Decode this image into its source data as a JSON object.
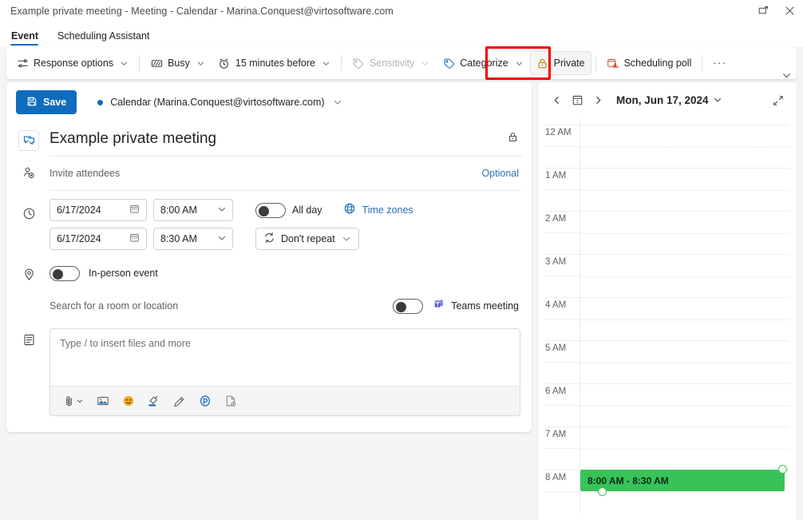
{
  "window": {
    "title": "Example private meeting - Meeting - Calendar - Marina.Conquest@virtosoftware.com",
    "popout_icon": "popout-icon",
    "close_icon": "close-icon"
  },
  "tabs": [
    {
      "label": "Event",
      "selected": true
    },
    {
      "label": "Scheduling Assistant",
      "selected": false
    }
  ],
  "ribbon": {
    "items": [
      {
        "label": "Response options",
        "icon": "response-options-icon",
        "chevron": true,
        "disabled": false
      },
      {
        "label": "Busy",
        "icon": "busy-icon",
        "chevron": true,
        "disabled": false
      },
      {
        "label": "15 minutes before",
        "icon": "reminder-clock-icon",
        "chevron": true,
        "disabled": false
      },
      {
        "label": "Sensitivity",
        "icon": "sensitivity-icon",
        "chevron": true,
        "disabled": true
      },
      {
        "label": "Categorize",
        "icon": "categorize-tag-icon",
        "chevron": true,
        "disabled": false
      },
      {
        "label": "Private",
        "icon": "private-lock-icon",
        "chevron": false,
        "disabled": false,
        "highlighted": true
      },
      {
        "label": "Scheduling poll",
        "icon": "scheduling-poll-icon",
        "chevron": false,
        "disabled": false
      }
    ],
    "overflow_label": "···",
    "expand_icon": "chevron-down-icon",
    "annotation_color": "#ee0000"
  },
  "form": {
    "save_label": "Save",
    "save_icon": "save-disk-icon",
    "save_color": "#0f6cbd",
    "calendar_label": "Calendar (Marina.Conquest@virtosoftware.com)",
    "calendar_dot_color": "#0f6cbd",
    "subject": "Example private meeting",
    "subject_icon": "teams-meeting-icon",
    "private_lock_icon": "lock-icon",
    "attendees_placeholder": "Invite attendees",
    "attendees_icon": "add-people-icon",
    "optional_label": "Optional",
    "clock_icon": "clock-icon",
    "start_date": "6/17/2024",
    "start_time": "8:00 AM",
    "end_date": "6/17/2024",
    "end_time": "8:30 AM",
    "date_picker_icon": "calendar-icon",
    "all_day_label": "All day",
    "all_day_on": false,
    "time_zones_label": "Time zones",
    "time_zones_icon": "globe-icon",
    "repeat_label": "Don't repeat",
    "repeat_icon": "repeat-icon",
    "location_icon": "location-pin-icon",
    "in_person_label": "In-person event",
    "in_person_on": false,
    "location_placeholder": "Search for a room or location",
    "teams_label": "Teams meeting",
    "teams_icon": "teams-icon",
    "teams_on": false,
    "description_icon": "description-icon",
    "body_placeholder": "Type / to insert files and more",
    "format_tools": [
      {
        "name": "attach-file-icon",
        "chevron": true
      },
      {
        "name": "insert-picture-icon",
        "chevron": false
      },
      {
        "name": "emoji-icon",
        "chevron": false
      },
      {
        "name": "highlighter-icon",
        "chevron": false
      },
      {
        "name": "draw-pen-icon",
        "chevron": false
      },
      {
        "name": "loop-component-icon",
        "chevron": false
      },
      {
        "name": "insert-document-icon",
        "chevron": false
      }
    ]
  },
  "calendar_pane": {
    "prev_icon": "chevron-left-icon",
    "today_icon": "today-calendar-icon",
    "next_icon": "chevron-right-icon",
    "date_label": "Mon, Jun 17, 2024",
    "date_chevron_icon": "chevron-down-icon",
    "expand_icon": "expand-diagonal-icon",
    "hours": [
      "12 AM",
      "1 AM",
      "2 AM",
      "3 AM",
      "4 AM",
      "5 AM",
      "6 AM",
      "7 AM",
      "8 AM"
    ],
    "event": {
      "label": "8:00 AM - 8:30 AM",
      "color": "#38c35a",
      "start_hour_index": 8,
      "duration_minutes": 30
    }
  }
}
